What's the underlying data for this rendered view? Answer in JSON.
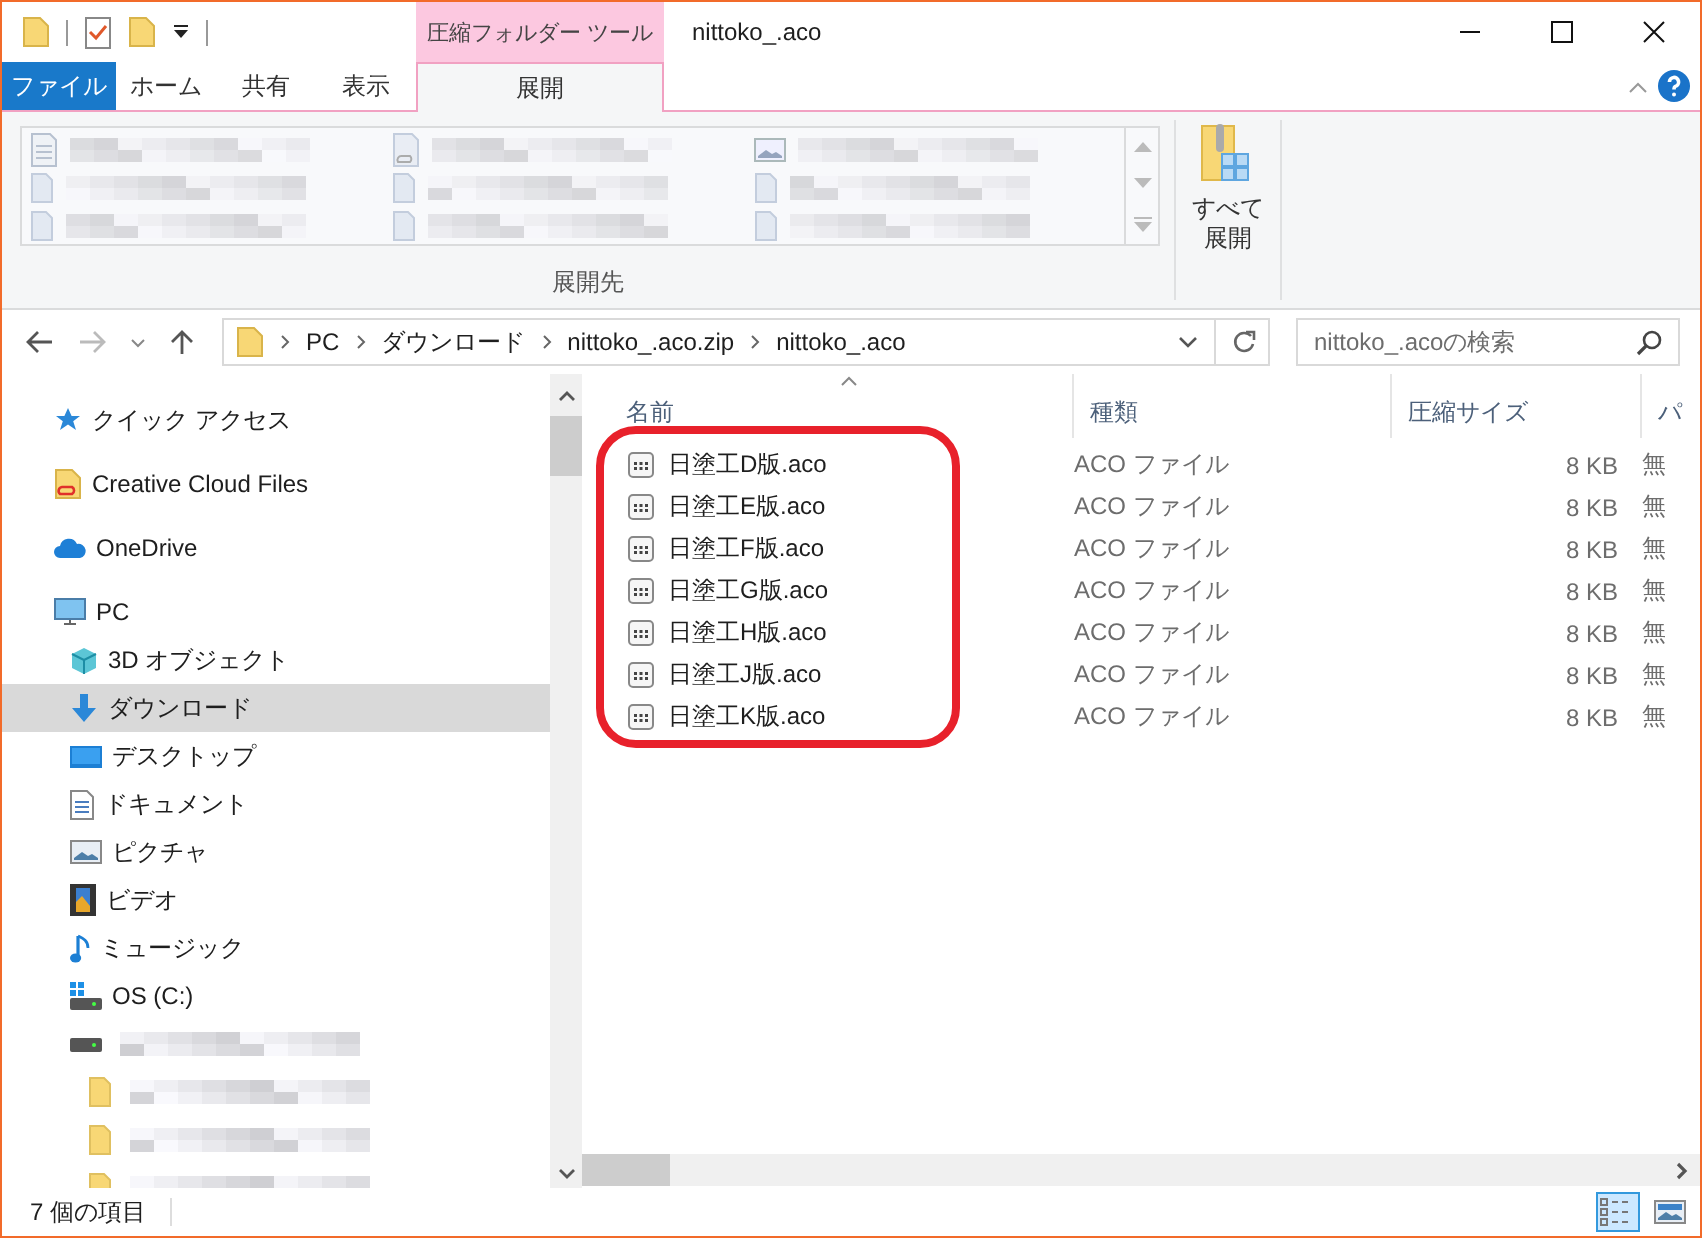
{
  "window": {
    "title": "nittoko_.aco",
    "context_header": "圧縮フォルダー ツール"
  },
  "ribbon": {
    "tabs": [
      {
        "label": "ファイル",
        "kind": "file",
        "selected": false
      },
      {
        "label": "ホーム",
        "kind": "tab",
        "selected": false
      },
      {
        "label": "共有",
        "kind": "tab",
        "selected": false
      },
      {
        "label": "表示",
        "kind": "tab",
        "selected": false
      },
      {
        "label": "展開",
        "kind": "context",
        "selected": true
      }
    ],
    "gallery": [
      {
        "kind": "document"
      },
      {
        "kind": "cloud"
      },
      {
        "kind": "picture"
      },
      {
        "kind": "folder"
      },
      {
        "kind": "folder"
      },
      {
        "kind": "folder"
      },
      {
        "kind": "folder"
      },
      {
        "kind": "folder"
      },
      {
        "kind": "folder"
      }
    ],
    "extract_all": "すべて展開",
    "group_label": "展開先"
  },
  "navigation": {
    "back": {
      "disabled": false
    },
    "forward": {
      "disabled": true
    },
    "breadcrumb": [
      "PC",
      "ダウンロード",
      "nittoko_.aco.zip",
      "nittoko_.aco"
    ],
    "search": {
      "placeholder": "nittoko_.acoの検索"
    }
  },
  "sidebar": {
    "items": [
      {
        "label": "クイック アクセス",
        "kind": "star",
        "selected": false
      },
      {
        "label": "Creative Cloud Files",
        "kind": "cc",
        "selected": false
      },
      {
        "label": "OneDrive",
        "kind": "cloud",
        "selected": false
      },
      {
        "label": "PC",
        "kind": "pc",
        "selected": false,
        "children": [
          {
            "label": "3D オブジェクト",
            "kind": "cube",
            "selected": false
          },
          {
            "label": "ダウンロード",
            "kind": "download",
            "selected": true
          },
          {
            "label": "デスクトップ",
            "kind": "desktop",
            "selected": false
          },
          {
            "label": "ドキュメント",
            "kind": "document",
            "selected": false
          },
          {
            "label": "ピクチャ",
            "kind": "picture",
            "selected": false
          },
          {
            "label": "ビデオ",
            "kind": "video",
            "selected": false
          },
          {
            "label": "ミュージック",
            "kind": "music",
            "selected": false
          },
          {
            "label": "OS (C:)",
            "kind": "windrive",
            "selected": false
          },
          {
            "kind": "drive",
            "selected": false,
            "children": [
              {
                "kind": "folder",
                "selected": false
              },
              {
                "kind": "folder",
                "selected": false
              },
              {
                "kind": "folder",
                "selected": false
              }
            ]
          }
        ]
      }
    ]
  },
  "file_list": {
    "highlight_outline": true,
    "columns": [
      {
        "label": "名前",
        "sorted": true
      },
      {
        "label": "種類",
        "sorted": false
      },
      {
        "label": "圧縮サイズ",
        "sorted": false
      },
      {
        "label": "パ",
        "sorted": false
      }
    ],
    "rows": [
      {
        "name": "日塗工D版.aco",
        "type": "ACO ファイル",
        "size": "8 KB",
        "column_4": "無"
      },
      {
        "name": "日塗工E版.aco",
        "type": "ACO ファイル",
        "size": "8 KB",
        "column_4": "無"
      },
      {
        "name": "日塗工F版.aco",
        "type": "ACO ファイル",
        "size": "8 KB",
        "column_4": "無"
      },
      {
        "name": "日塗工G版.aco",
        "type": "ACO ファイル",
        "size": "8 KB",
        "column_4": "無"
      },
      {
        "name": "日塗工H版.aco",
        "type": "ACO ファイル",
        "size": "8 KB",
        "column_4": "無"
      },
      {
        "name": "日塗工J版.aco",
        "type": "ACO ファイル",
        "size": "8 KB",
        "column_4": "無"
      },
      {
        "name": "日塗工K版.aco",
        "type": "ACO ファイル",
        "size": "8 KB",
        "column_4": "無"
      }
    ]
  },
  "status_bar": {
    "count": "7 個の項目",
    "view_buttons": [
      {
        "kind": "details",
        "selected": true
      },
      {
        "kind": "large",
        "selected": false
      }
    ]
  }
}
